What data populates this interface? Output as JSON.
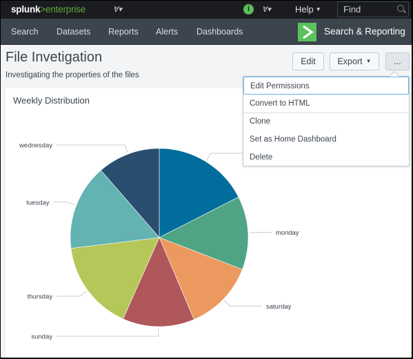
{
  "topbar": {
    "logo_word": "splunk",
    "logo_product": ">enterprise",
    "info_icon": "i",
    "help_label": "Help",
    "find_placeholder": "Find"
  },
  "navbar": {
    "items": [
      "Search",
      "Datasets",
      "Reports",
      "Alerts",
      "Dashboards"
    ],
    "app_name": "Search & Reporting"
  },
  "dashboard": {
    "title": "File Invetigation",
    "description": "Investigating the properties of the files",
    "edit_label": "Edit",
    "export_label": "Export",
    "more_label": "..."
  },
  "more_menu": {
    "items": [
      "Edit Permissions",
      "Convert to HTML",
      "Clone",
      "Set as Home Dashboard",
      "Delete"
    ]
  },
  "panel": {
    "title": "Weekly Distribution"
  },
  "chart_data": {
    "type": "pie",
    "title": "Weekly Distribution",
    "start": "12 o'clock, clockwise",
    "slices": [
      {
        "label": "",
        "value": 63,
        "color": "#006d9c"
      },
      {
        "label": "monday",
        "value": 48,
        "color": "#4fa484"
      },
      {
        "label": "saturday",
        "value": 46,
        "color": "#ec9960"
      },
      {
        "label": "sunday",
        "value": 47,
        "color": "#af575a"
      },
      {
        "label": "thursday",
        "value": 59,
        "color": "#b6c75a"
      },
      {
        "label": "tuesday",
        "value": 56,
        "color": "#62b3b2"
      },
      {
        "label": "wednesday",
        "value": 41,
        "color": "#294e70"
      }
    ]
  }
}
